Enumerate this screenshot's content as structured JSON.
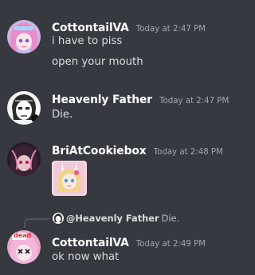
{
  "messages": [
    {
      "author": "CottontailVA",
      "timestamp": "Today at 2:47 PM",
      "avatar_icon": "anime-avatar-pink-hair",
      "lines": [
        "i have to piss",
        "open your mouth"
      ]
    },
    {
      "author": "Heavenly Father",
      "timestamp": "Today at 2:47 PM",
      "avatar_icon": "sketched-face-avatar",
      "lines": [
        "Die."
      ]
    },
    {
      "author": "BriAtCookiebox",
      "timestamp": "Today at 2:48 PM",
      "avatar_icon": "dark-anime-avatar",
      "sticker_icon": "anime-bunny-girl-sticker"
    },
    {
      "reply_to": {
        "mention": "@Heavenly Father",
        "text": "Die."
      },
      "author": "CottontailVA",
      "timestamp": "Today at 2:49 PM",
      "avatar_icon": "dead-anime-avatar",
      "avatar_badge": "dead",
      "lines": [
        "ok now what"
      ]
    }
  ],
  "colors": {
    "background": "#36393f",
    "username": "#ffffff",
    "message_text": "#dcddde",
    "timestamp": "#a3a6aa"
  }
}
